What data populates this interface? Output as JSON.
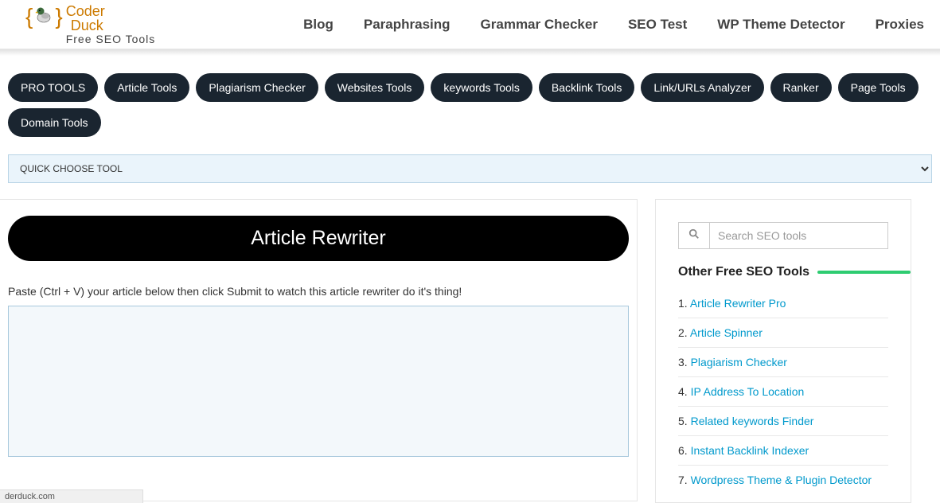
{
  "logo": {
    "text_top": "Coder",
    "text_bottom": "Duck",
    "subtitle": "Free SEO Tools"
  },
  "main_nav": [
    "Blog",
    "Paraphrasing",
    "Grammar Checker",
    "SEO Test",
    "WP Theme Detector",
    "Proxies"
  ],
  "pill_nav": [
    "PRO TOOLS",
    "Article Tools",
    "Plagiarism Checker",
    "Websites Tools",
    "keywords Tools",
    "Backlink Tools",
    "Link/URLs Analyzer",
    "Ranker",
    "Page Tools",
    "Domain Tools"
  ],
  "quick_select": {
    "selected": "QUICK CHOOSE TOOL"
  },
  "tool": {
    "title": "Article Rewriter",
    "instruction": "Paste (Ctrl + V) your article below then click Submit to watch this article rewriter do it's thing!"
  },
  "sidebar": {
    "search_placeholder": "Search SEO tools",
    "heading": "Other Free SEO Tools",
    "items": [
      {
        "num": "1.",
        "label": "Article Rewriter Pro"
      },
      {
        "num": "2.",
        "label": "Article Spinner"
      },
      {
        "num": "3.",
        "label": "Plagiarism Checker"
      },
      {
        "num": "4.",
        "label": "IP Address To Location"
      },
      {
        "num": "5.",
        "label": "Related keywords Finder"
      },
      {
        "num": "6.",
        "label": "Instant Backlink Indexer"
      },
      {
        "num": "7.",
        "label": "Wordpress Theme & Plugin Detector"
      }
    ]
  },
  "status_hint": "derduck.com"
}
